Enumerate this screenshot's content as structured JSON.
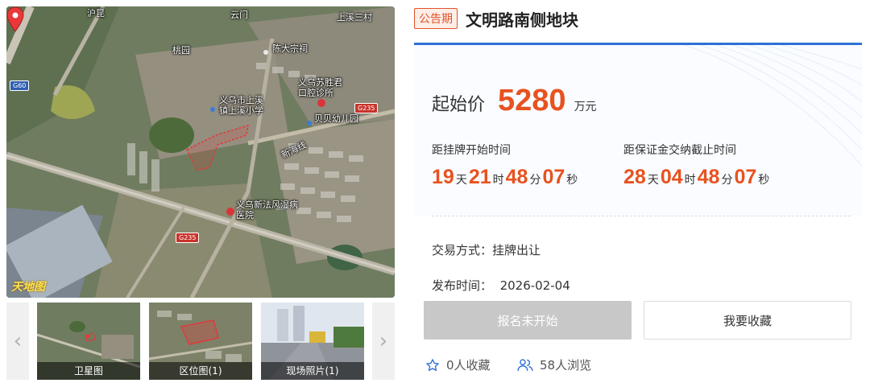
{
  "map": {
    "labels": {
      "shanghai_kun": "沪昆",
      "yunmen": "云门",
      "shangxi_sancun": "上溪三村",
      "taoyuan": "桃园",
      "chen_dazongci": "陈大宗祠",
      "yiwu_shengjie_clinic": "义乌苏胜君\n口腔诊所",
      "shangxi_primary": "义乌市上溪\n镇上溪小学",
      "beibei_kindergarten": "贝贝幼儿园",
      "xinhai_line": "新海线",
      "xinfa_hospital": "义乌新法风湿病\n医院",
      "watermark": "天地图"
    },
    "roads": {
      "g60": "G60",
      "g235_a": "G235",
      "g235_b": "G235"
    }
  },
  "gallery": {
    "prev_arrow": "‹",
    "next_arrow": "›",
    "thumbs": [
      {
        "caption": "卫星图"
      },
      {
        "caption": "区位图(1)"
      },
      {
        "caption": "现场照片(1)"
      }
    ]
  },
  "listing": {
    "status_badge": "公告期",
    "title": "文明路南侧地块",
    "price_label": "起始价",
    "price_value": "5280",
    "price_unit": "万元",
    "countdown_start": {
      "label": "距挂牌开始时间",
      "days": "19",
      "hours": "21",
      "minutes": "48",
      "seconds": "07"
    },
    "countdown_deposit": {
      "label": "距保证金交纳截止时间",
      "days": "28",
      "hours": "04",
      "minutes": "48",
      "seconds": "07"
    },
    "units": {
      "day": "天",
      "hour": "时",
      "minute": "分",
      "second": "秒"
    },
    "trade_method_label": "交易方式：",
    "trade_method_value": "挂牌出让",
    "publish_label": "发布时间：",
    "publish_value": "2026-02-04",
    "register_button": "报名未开始",
    "favorite_button": "我要收藏",
    "favorites_count": "0",
    "favorites_suffix": "人收藏",
    "views_count": "58",
    "views_suffix": "人浏览"
  },
  "colors": {
    "accent_orange": "#e8521f",
    "accent_blue": "#2f6fd6",
    "disabled_gray": "#c8c8c8"
  }
}
